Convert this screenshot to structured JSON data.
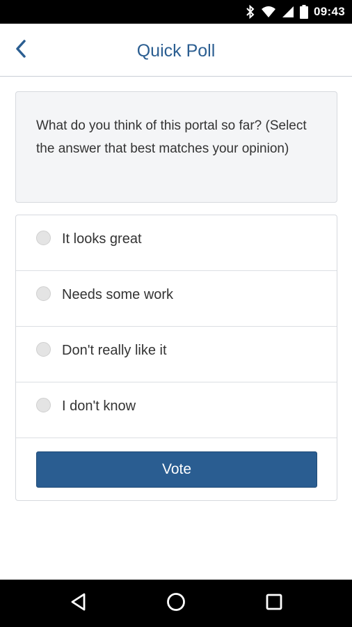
{
  "status_bar": {
    "time": "09:43",
    "icons": [
      "bluetooth-icon",
      "wifi-icon",
      "cell-signal-icon",
      "battery-icon"
    ]
  },
  "app_bar": {
    "title": "Quick Poll",
    "back_icon": "chevron-left-icon"
  },
  "poll": {
    "question": "What do you think of this portal so far? (Select the answer that best matches your opinion)",
    "options": [
      {
        "label": "It looks great",
        "selected": false
      },
      {
        "label": "Needs some work",
        "selected": false
      },
      {
        "label": "Don't really like it",
        "selected": false
      },
      {
        "label": "I don't know",
        "selected": false
      }
    ],
    "vote_label": "Vote"
  },
  "nav_bar": {
    "icons": [
      "back-triangle-icon",
      "home-circle-icon",
      "recents-square-icon"
    ]
  },
  "colors": {
    "accent": "#2a5d91",
    "title": "#2b5e91",
    "card_bg": "#f4f5f7",
    "border": "#d6d9de"
  }
}
